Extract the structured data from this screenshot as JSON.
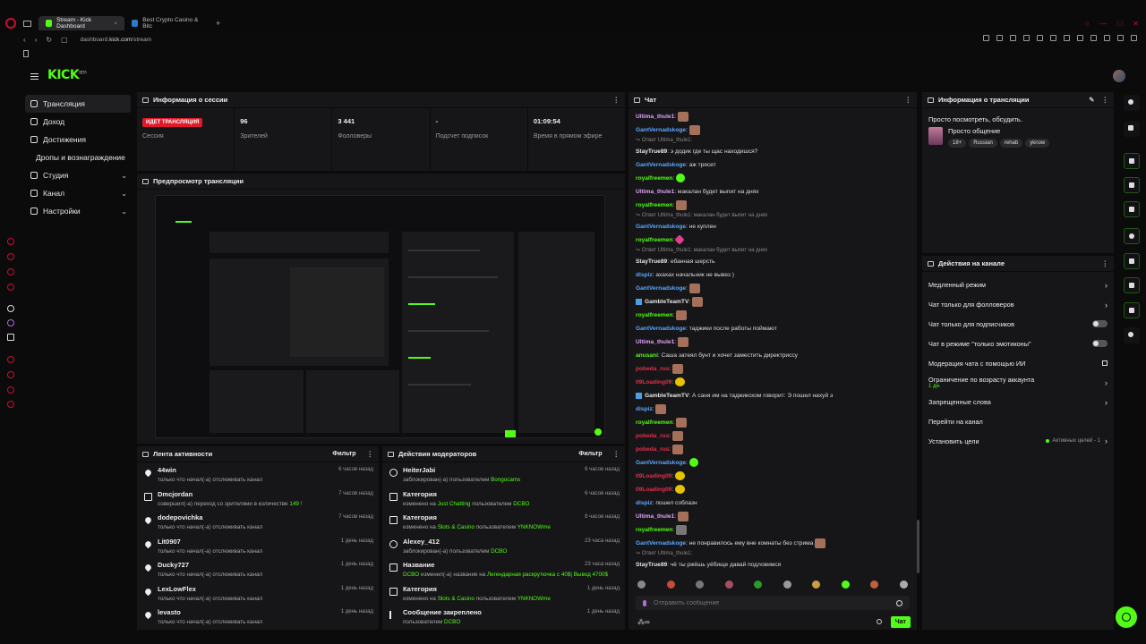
{
  "browser": {
    "tabs": [
      {
        "label": "Stream - Kick Dashboard",
        "active": true
      },
      {
        "label": "Best Crypto Casino & Bitc",
        "active": false
      }
    ],
    "url_prefix": "dashboard.",
    "url_host": "kick.com",
    "url_path": "/stream"
  },
  "app": {
    "logo": "KICK",
    "logo_sup": "BETA"
  },
  "sidebar": {
    "items": [
      {
        "label": "Трансляция"
      },
      {
        "label": "Доход"
      },
      {
        "label": "Достижения"
      },
      {
        "label": "Дропы и вознаграждение"
      },
      {
        "label": "Студия"
      },
      {
        "label": "Канал"
      },
      {
        "label": "Настройки"
      }
    ]
  },
  "session": {
    "title": "Информация о сессии",
    "live_badge": "ИДЕТ ТРАНСЛЯЦИЯ",
    "session_label": "Сессия",
    "stats": [
      {
        "value": "96",
        "label": "Зрителей"
      },
      {
        "value": "3 441",
        "label": "Фолловеры"
      },
      {
        "value": "-",
        "label": "Подсчет подписок"
      },
      {
        "value": "01:09:54",
        "label": "Время в прямом эфире"
      }
    ]
  },
  "preview": {
    "title": "Предпросмотр трансляции"
  },
  "activity": {
    "title": "Лента активности",
    "filter": "Фильтр",
    "items": [
      {
        "name": "44win",
        "desc": "только что начал(-а) отслеживать канал",
        "time": "6 часов назад",
        "icon": "heart"
      },
      {
        "name": "Dmcjordan",
        "desc_pre": "совершил(-а) переход со зрителями в количестве ",
        "desc_hl": "149",
        "desc_post": " !",
        "time": "7 часов назад",
        "icon": "gift"
      },
      {
        "name": "dodepovichka",
        "desc": "только что начал(-а) отслеживать канал",
        "time": "7 часов назад",
        "icon": "heart"
      },
      {
        "name": "Lit0907",
        "desc": "только что начал(-а) отслеживать канал",
        "time": "1 день назад",
        "icon": "heart"
      },
      {
        "name": "Ducky727",
        "desc": "только что начал(-а) отслеживать канал",
        "time": "1 день назад",
        "icon": "heart"
      },
      {
        "name": "LexLowFlex",
        "desc": "только что начал(-а) отслеживать канал",
        "time": "1 день назад",
        "icon": "heart"
      },
      {
        "name": "levasto",
        "desc": "только что начал(-а) отслеживать канал",
        "time": "1 день назад",
        "icon": "heart"
      }
    ]
  },
  "mods": {
    "title": "Действия модераторов",
    "filter": "Фильтр",
    "items": [
      {
        "name": "HeiterJabi",
        "p1": "заблокирован(-а) пользователем ",
        "h1": "Bongocams",
        "p2": "",
        "h2": "",
        "time": "6 часов назад",
        "icon": "ban"
      },
      {
        "name": "Категория",
        "p1": "изменено на ",
        "h1": "Just Chatting",
        "p2": " пользователем ",
        "h2": "DCBO",
        "time": "6 часов назад",
        "icon": "gift"
      },
      {
        "name": "Категория",
        "p1": "изменено на ",
        "h1": "Slots & Casino",
        "p2": " пользователем ",
        "h2": "YNKNOWme",
        "time": "8 часов назад",
        "icon": "gift"
      },
      {
        "name": "Alexey_412",
        "p1": "заблокирован(-а) пользователем ",
        "h1": "DCBO",
        "p2": "",
        "h2": "",
        "time": "23 часа назад",
        "icon": "ban"
      },
      {
        "name": "Название",
        "p1": "",
        "h1": "DCBO",
        "p2": " изменил(-а) название на ",
        "h2": "Легендарная раскрутючка с 40$| Вывод 4700$",
        "time": "23 часа назад",
        "icon": "gift"
      },
      {
        "name": "Категория",
        "p1": "изменено на ",
        "h1": "Slots & Casino",
        "p2": " пользователем ",
        "h2": "YNKNOWme",
        "time": "1 день назад",
        "icon": "gift"
      },
      {
        "name": "Сообщение закреплено",
        "p1": "пользователем ",
        "h1": "DCBO",
        "p2": "",
        "h2": "",
        "time": "1 день назад",
        "icon": "pin"
      }
    ]
  },
  "chat": {
    "title": "Чат",
    "placeholder": "Отправить сообщение",
    "send": "Чат",
    "messages": [
      {
        "type": "msg",
        "user": "Ultima_thule1",
        "color": "#e0a0ff",
        "text": "",
        "emote": "e"
      },
      {
        "type": "msg",
        "user": "GantVernadskoge",
        "color": "#5aa8ff",
        "text": "",
        "emote": "e"
      },
      {
        "type": "reply",
        "text": "↪ Ответ Ultima_thule1:"
      },
      {
        "type": "msg",
        "user": "StayTrue89",
        "color": "#e6e6e6",
        "text": "э додик где ты щас находишся?"
      },
      {
        "type": "msg",
        "user": "GantVernadskoge",
        "color": "#5aa8ff",
        "text": "аж трясет"
      },
      {
        "type": "msg",
        "user": "royalfreemen",
        "color": "#53fc18",
        "text": "",
        "emote": "g"
      },
      {
        "type": "msg",
        "user": "Ultima_thule1",
        "color": "#e0a0ff",
        "text": "макалан будет выпит на днях"
      },
      {
        "type": "msg",
        "user": "royalfreemen",
        "color": "#53fc18",
        "text": "",
        "emote": "e"
      },
      {
        "type": "reply",
        "text": "↪ Ответ Ultima_thule1: макалан будет выпит на днях"
      },
      {
        "type": "msg",
        "user": "GantVernadskoge",
        "color": "#5aa8ff",
        "text": "не куплен"
      },
      {
        "type": "msg",
        "user": "royalfreemen",
        "color": "#53fc18",
        "text": "",
        "emote": "p"
      },
      {
        "type": "reply",
        "text": "↪ Ответ Ultima_thule1: макалан будет выпит на днях"
      },
      {
        "type": "msg",
        "user": "StayTrue89",
        "color": "#e6e6e6",
        "text": "ебанная шерсть"
      },
      {
        "type": "msg",
        "user": "dispiz",
        "color": "#5aa8ff",
        "text": "ахахах начальник не вывез )"
      },
      {
        "type": "msg",
        "user": "GantVernadskoge",
        "color": "#5aa8ff",
        "text": "",
        "emote": "e"
      },
      {
        "type": "msg",
        "user": "GambleTeamTV",
        "color": "#e6e6e6",
        "text": "",
        "emote": "e",
        "badge": true
      },
      {
        "type": "msg",
        "user": "royalfreemen",
        "color": "#53fc18",
        "text": "",
        "emote": "e"
      },
      {
        "type": "msg",
        "user": "GantVernadskoge",
        "color": "#5aa8ff",
        "text": "таджики после работы поймают"
      },
      {
        "type": "msg",
        "user": "Ultima_thule1",
        "color": "#e0a0ff",
        "text": "",
        "emote": "e"
      },
      {
        "type": "msg",
        "user": "anusani",
        "color": "#53fc18",
        "text": "Саша затеял бунт и хочет заместить директриссу"
      },
      {
        "type": "msg",
        "user": "pobeda_rus",
        "color": "#e0304a",
        "text": "",
        "emote": "e"
      },
      {
        "type": "msg",
        "user": "09Loading09",
        "color": "#e0304a",
        "text": "",
        "emote": "y"
      },
      {
        "type": "msg",
        "user": "GambleTeamTV",
        "color": "#e6e6e6",
        "text": "А саня им на таджикском говорит: Э пошел нахуй э",
        "badge": true
      },
      {
        "type": "msg",
        "user": "dispiz",
        "color": "#5aa8ff",
        "text": "",
        "emote": "e"
      },
      {
        "type": "msg",
        "user": "royalfreemen",
        "color": "#53fc18",
        "text": "",
        "emote": "e"
      },
      {
        "type": "msg",
        "user": "pobeda_rus",
        "color": "#e0304a",
        "text": "",
        "emote": "e"
      },
      {
        "type": "msg",
        "user": "pobeda_rus",
        "color": "#e0304a",
        "text": "",
        "emote": "e"
      },
      {
        "type": "msg",
        "user": "GantVernadskoge",
        "color": "#5aa8ff",
        "text": "",
        "emote": "g"
      },
      {
        "type": "msg",
        "user": "09Loading09",
        "color": "#e0304a",
        "text": "",
        "emote": "y"
      },
      {
        "type": "msg",
        "user": "09Loading09",
        "color": "#e0304a",
        "text": "",
        "emote": "y"
      },
      {
        "type": "msg",
        "user": "dispiz",
        "color": "#5aa8ff",
        "text": "пошел соблазн"
      },
      {
        "type": "msg",
        "user": "Ultima_thule1",
        "color": "#e0a0ff",
        "text": "",
        "emote": "e"
      },
      {
        "type": "msg",
        "user": "royalfreemen",
        "color": "#53fc18",
        "text": "",
        "emote": "gray"
      },
      {
        "type": "msg",
        "user": "GantVernadskoge",
        "color": "#5aa8ff",
        "text": "не понравилось ему вне комнаты без стрима",
        "emote": "e"
      },
      {
        "type": "reply",
        "text": "↪ Ответ Ultima_thule1:"
      },
      {
        "type": "msg",
        "user": "StayTrue89",
        "color": "#e6e6e6",
        "text": "чё ты ржёшь уёбище давай подловимся"
      }
    ]
  },
  "stream_info": {
    "title": "Информация о трансляции",
    "stream_title": "Просто посмотреть, обсудить.",
    "category": "Просто общение",
    "tags": [
      "18+",
      "Russian",
      "rehab",
      "yknow"
    ]
  },
  "channel": {
    "title": "Действия на канале",
    "options": [
      {
        "label": "Медленный режим",
        "kind": "arrow"
      },
      {
        "label": "Чат только для фолловеров",
        "kind": "arrow"
      },
      {
        "label": "Чат только для подписчиков",
        "kind": "toggle"
      },
      {
        "label": "Чат в режиме \"только эмотиконы\"",
        "kind": "toggle"
      },
      {
        "label": "Модерация чата с помощью ИИ",
        "kind": "ext"
      },
      {
        "label": "Ограничение по возрасту аккаунта",
        "sub": "1 дн.",
        "kind": "arrow"
      },
      {
        "label": "Запрещенные слова",
        "kind": "arrow"
      },
      {
        "label": "Перейти на канал",
        "kind": "none"
      },
      {
        "label": "Установить цели",
        "kind": "goals",
        "goals": "Активных целей - 1"
      }
    ]
  }
}
